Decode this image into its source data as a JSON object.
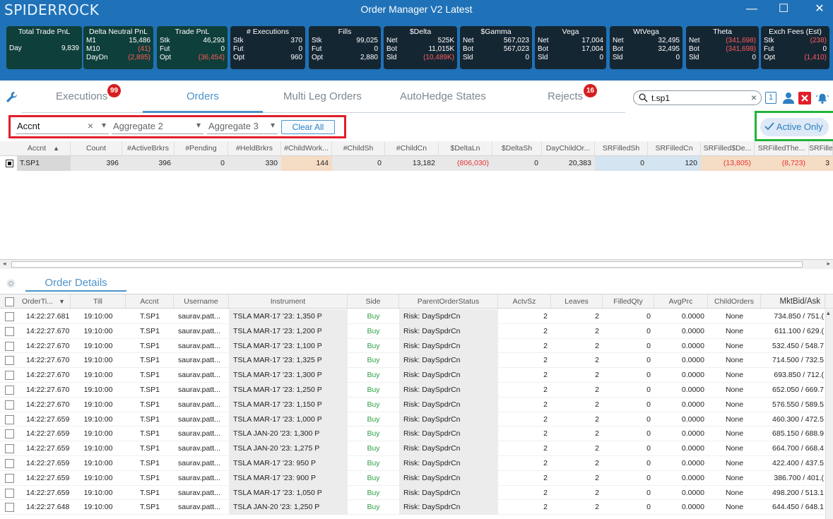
{
  "app": {
    "logo": "SPIDERROCK",
    "title": "Order Manager V2 Latest"
  },
  "window_buttons": {
    "minimize": "—",
    "maximize": "☐",
    "close": "✕"
  },
  "stats": [
    {
      "title": "Total Trade PnL",
      "rows": [
        [
          "Day",
          "",
          "9,839"
        ]
      ],
      "dark": true
    },
    {
      "title": "Delta Neutral PnL",
      "rows": [
        [
          "M1",
          "15,486"
        ],
        [
          "M10",
          "(41)"
        ],
        [
          "DayDn",
          "(2,895)"
        ]
      ],
      "dark": true
    },
    {
      "title": "Trade PnL",
      "rows": [
        [
          "Stk",
          "46,293"
        ],
        [
          "Fut",
          "0"
        ],
        [
          "Opt",
          "(36,454)"
        ]
      ],
      "dark": true
    },
    {
      "title": "# Executions",
      "rows": [
        [
          "Stk",
          "370"
        ],
        [
          "Fut",
          "0"
        ],
        [
          "Opt",
          "960"
        ]
      ]
    },
    {
      "title": "Fills",
      "rows": [
        [
          "Stk",
          "99,025"
        ],
        [
          "Fut",
          "0"
        ],
        [
          "Opt",
          "2,880"
        ]
      ]
    },
    {
      "title": "$Delta",
      "rows": [
        [
          "Net",
          "525K"
        ],
        [
          "Bot",
          "11,015K"
        ],
        [
          "Sld",
          "(10,489K)"
        ]
      ]
    },
    {
      "title": "$Gamma",
      "rows": [
        [
          "Net",
          "567,023"
        ],
        [
          "Bot",
          "567,023"
        ],
        [
          "Sld",
          "0"
        ]
      ]
    },
    {
      "title": "Vega",
      "rows": [
        [
          "Net",
          "17,004"
        ],
        [
          "Bot",
          "17,004"
        ],
        [
          "Sld",
          "0"
        ]
      ]
    },
    {
      "title": "WtVega",
      "rows": [
        [
          "Net",
          "32,495"
        ],
        [
          "Bot",
          "32,495"
        ],
        [
          "Sld",
          "0"
        ]
      ]
    },
    {
      "title": "Theta",
      "rows": [
        [
          "Net",
          "(341,698)"
        ],
        [
          "Bot",
          "(341,698)"
        ],
        [
          "Sld",
          "0"
        ]
      ]
    },
    {
      "title": "Exch Fees (Est)",
      "rows": [
        [
          "Stk",
          "(238)"
        ],
        [
          "Fut",
          "0"
        ],
        [
          "Opt",
          "(1,410)"
        ]
      ]
    }
  ],
  "tabs": [
    {
      "label": "Executions",
      "badge": "99"
    },
    {
      "label": "Orders",
      "badge": ""
    },
    {
      "label": "Multi Leg Orders",
      "badge": ""
    },
    {
      "label": "AutoHedge States",
      "badge": ""
    },
    {
      "label": "Rejects",
      "badge": "16"
    }
  ],
  "search": {
    "value": "t.sp1",
    "clear": "×"
  },
  "toolbar_icons": {
    "one": "1"
  },
  "filters": {
    "group1": {
      "value": "Accnt",
      "clear": "×",
      "caret": "▾"
    },
    "group2": {
      "value": "Aggregate 2",
      "caret": "▾"
    },
    "group3": {
      "value": "Aggregate 3",
      "caret": "▾"
    },
    "clear_all": "Clear All",
    "active_only": "Active Only"
  },
  "summary_grid": {
    "columns": [
      "Accnt",
      "Count",
      "#ActiveBrkrs",
      "#Pending",
      "#HeldBrkrs",
      "#ChildWork...",
      "#ChildSh",
      "#ChildCn",
      "$DeltaLn",
      "$DeltaSh",
      "DayChildOr...",
      "SRFilledSh",
      "SRFilledCn",
      "SRFilled$De...",
      "SRFilledThe...",
      "SRFille"
    ],
    "sort_indicator": "▲",
    "rows": [
      [
        "T.SP1",
        "396",
        "396",
        "0",
        "330",
        "144",
        "0",
        "13,182",
        "(806,030)",
        "0",
        "20,383",
        "0",
        "120",
        "(13,805)",
        "(8,723)",
        "3"
      ]
    ]
  },
  "order_details": {
    "tab_label": "Order Details",
    "columns": [
      "OrderTi...",
      "Till",
      "Accnt",
      "Username",
      "Instrument",
      "Side",
      "ParentOrderStatus",
      "ActvSz",
      "Leaves",
      "FilledQty",
      "AvgPrc",
      "ChildOrders",
      "MktBid/Ask"
    ],
    "sort_indicator": "▼",
    "rows": [
      [
        "14:22:27.681",
        "19:10:00",
        "T.SP1",
        "saurav.patt...",
        "TSLA MAR-17 '23: 1,350 P",
        "Buy",
        "Risk: DaySpdrCn",
        "2",
        "2",
        "0",
        "0.0000",
        "None",
        "734.850 / 751.("
      ],
      [
        "14:22:27.670",
        "19:10:00",
        "T.SP1",
        "saurav.patt...",
        "TSLA MAR-17 '23: 1,200 P",
        "Buy",
        "Risk: DaySpdrCn",
        "2",
        "2",
        "0",
        "0.0000",
        "None",
        "611.100 / 629.("
      ],
      [
        "14:22:27.670",
        "19:10:00",
        "T.SP1",
        "saurav.patt...",
        "TSLA MAR-17 '23: 1,100 P",
        "Buy",
        "Risk: DaySpdrCn",
        "2",
        "2",
        "0",
        "0.0000",
        "None",
        "532.450 / 548.7"
      ],
      [
        "14:22:27.670",
        "19:10:00",
        "T.SP1",
        "saurav.patt...",
        "TSLA MAR-17 '23: 1,325 P",
        "Buy",
        "Risk: DaySpdrCn",
        "2",
        "2",
        "0",
        "0.0000",
        "None",
        "714.500 / 732.5"
      ],
      [
        "14:22:27.670",
        "19:10:00",
        "T.SP1",
        "saurav.patt...",
        "TSLA MAR-17 '23: 1,300 P",
        "Buy",
        "Risk: DaySpdrCn",
        "2",
        "2",
        "0",
        "0.0000",
        "None",
        "693.850 / 712.("
      ],
      [
        "14:22:27.670",
        "19:10:00",
        "T.SP1",
        "saurav.patt...",
        "TSLA MAR-17 '23: 1,250 P",
        "Buy",
        "Risk: DaySpdrCn",
        "2",
        "2",
        "0",
        "0.0000",
        "None",
        "652.050 / 669.7"
      ],
      [
        "14:22:27.670",
        "19:10:00",
        "T.SP1",
        "saurav.patt...",
        "TSLA MAR-17 '23: 1,150 P",
        "Buy",
        "Risk: DaySpdrCn",
        "2",
        "2",
        "0",
        "0.0000",
        "None",
        "576.550 / 589.5"
      ],
      [
        "14:22:27.659",
        "19:10:00",
        "T.SP1",
        "saurav.patt...",
        "TSLA MAR-17 '23: 1,000 P",
        "Buy",
        "Risk: DaySpdrCn",
        "2",
        "2",
        "0",
        "0.0000",
        "None",
        "460.300 / 472.5"
      ],
      [
        "14:22:27.659",
        "19:10:00",
        "T.SP1",
        "saurav.patt...",
        "TSLA JAN-20 '23: 1,300 P",
        "Buy",
        "Risk: DaySpdrCn",
        "2",
        "2",
        "0",
        "0.0000",
        "None",
        "685.150 / 688.9"
      ],
      [
        "14:22:27.659",
        "19:10:00",
        "T.SP1",
        "saurav.patt...",
        "TSLA JAN-20 '23: 1,275 P",
        "Buy",
        "Risk: DaySpdrCn",
        "2",
        "2",
        "0",
        "0.0000",
        "None",
        "664.700 / 668.4"
      ],
      [
        "14:22:27.659",
        "19:10:00",
        "T.SP1",
        "saurav.patt...",
        "TSLA MAR-17 '23: 950 P",
        "Buy",
        "Risk: DaySpdrCn",
        "2",
        "2",
        "0",
        "0.0000",
        "None",
        "422.400 / 437.5"
      ],
      [
        "14:22:27.659",
        "19:10:00",
        "T.SP1",
        "saurav.patt...",
        "TSLA MAR-17 '23: 900 P",
        "Buy",
        "Risk: DaySpdrCn",
        "2",
        "2",
        "0",
        "0.0000",
        "None",
        "386.700 / 401.("
      ],
      [
        "14:22:27.659",
        "19:10:00",
        "T.SP1",
        "saurav.patt...",
        "TSLA MAR-17 '23: 1,050 P",
        "Buy",
        "Risk: DaySpdrCn",
        "2",
        "2",
        "0",
        "0.0000",
        "None",
        "498.200 / 513.1"
      ],
      [
        "14:22:27.648",
        "19:10:00",
        "T.SP1",
        "saurav.patt...",
        "TSLA JAN-20 '23: 1,250 P",
        "Buy",
        "Risk: DaySpdrCn",
        "2",
        "2",
        "0",
        "0.0000",
        "None",
        "644.450 / 648.1"
      ]
    ]
  },
  "colors": {
    "brand": "#1f72b8",
    "accent": "#4e93c9",
    "negative": "#e53535",
    "buy": "#2ea043",
    "highlight_red": "#e11e2a",
    "highlight_green": "#21b33b"
  }
}
